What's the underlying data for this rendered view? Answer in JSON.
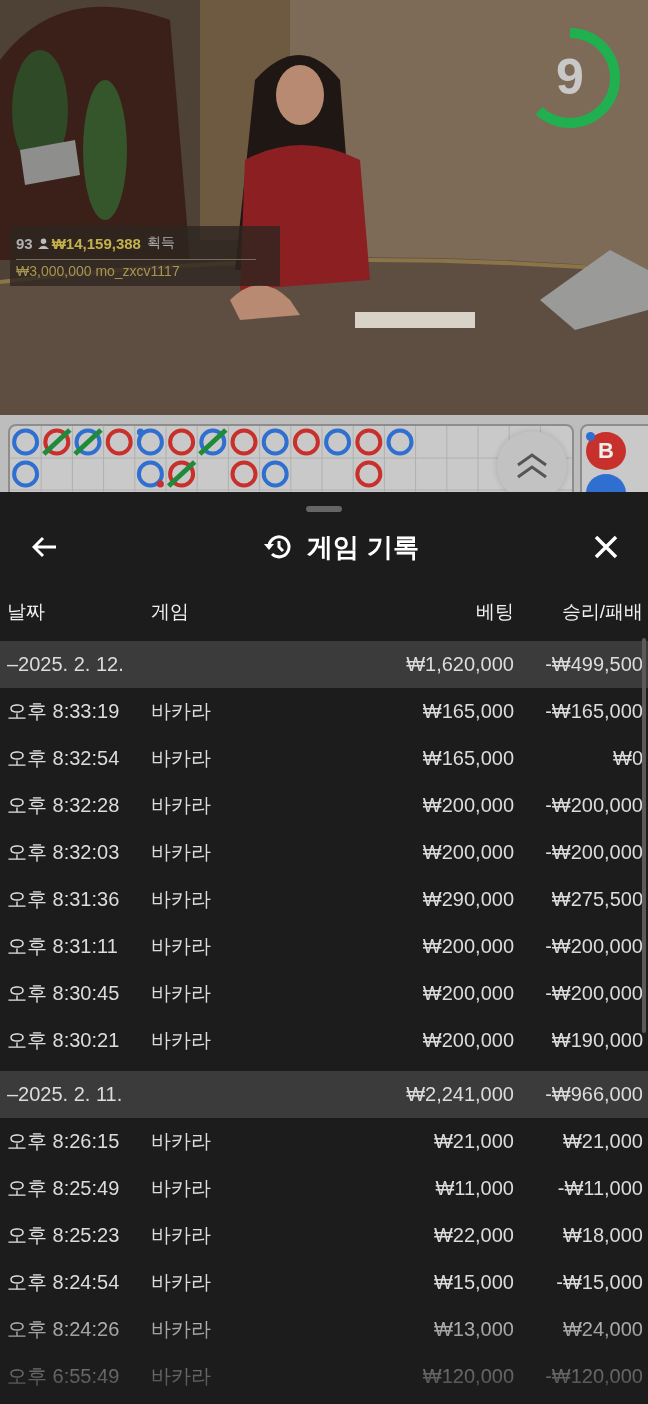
{
  "video": {
    "kind": "picture",
    "timer": {
      "value": "9",
      "level": 0.62
    },
    "winner": {
      "count": "93",
      "amount": "₩14,159,388",
      "label": "획득"
    },
    "bet_feed": "₩3,000,000 mo_zxcv1117"
  },
  "bead_road": {
    "columns": [
      [
        {
          "color": "#2f6fd0",
          "tie": false,
          "player_pair": false,
          "banker_pair": false
        },
        {
          "color": "#2f6fd0",
          "tie": false,
          "player_pair": false,
          "banker_pair": false
        }
      ],
      [
        {
          "color": "#c8302c",
          "tie": true,
          "player_pair": false,
          "banker_pair": false
        }
      ],
      [
        {
          "color": "#2f6fd0",
          "tie": true,
          "player_pair": false,
          "banker_pair": false
        }
      ],
      [
        {
          "color": "#c8302c",
          "tie": false,
          "player_pair": false,
          "banker_pair": false
        }
      ],
      [
        {
          "color": "#2f6fd0",
          "tie": false,
          "player_pair": true,
          "banker_pair": false
        },
        {
          "color": "#2f6fd0",
          "tie": false,
          "player_pair": false,
          "banker_pair": true
        }
      ],
      [
        {
          "color": "#c8302c",
          "tie": false,
          "player_pair": false,
          "banker_pair": false
        },
        {
          "color": "#c8302c",
          "tie": true,
          "player_pair": false,
          "banker_pair": false
        }
      ],
      [
        {
          "color": "#2f6fd0",
          "tie": true,
          "player_pair": false,
          "banker_pair": false
        }
      ],
      [
        {
          "color": "#c8302c",
          "tie": false,
          "player_pair": false,
          "banker_pair": false
        },
        {
          "color": "#c8302c",
          "tie": false,
          "player_pair": false,
          "banker_pair": false
        }
      ],
      [
        {
          "color": "#2f6fd0",
          "tie": false,
          "player_pair": false,
          "banker_pair": false
        },
        {
          "color": "#2f6fd0",
          "tie": false,
          "player_pair": false,
          "banker_pair": false
        }
      ],
      [
        {
          "color": "#c8302c",
          "tie": false,
          "player_pair": false,
          "banker_pair": false
        }
      ],
      [
        {
          "color": "#2f6fd0",
          "tie": false,
          "player_pair": false,
          "banker_pair": false
        }
      ],
      [
        {
          "color": "#c8302c",
          "tie": false,
          "player_pair": false,
          "banker_pair": false
        },
        {
          "color": "#c8302c",
          "tie": false,
          "player_pair": false,
          "banker_pair": false
        }
      ],
      [
        {
          "color": "#2f6fd0",
          "tie": false,
          "player_pair": false,
          "banker_pair": false
        }
      ]
    ]
  },
  "side_road": [
    {
      "label": "B",
      "color": "#c8302c",
      "player_pair": true
    },
    {
      "color": "#2f6fd0",
      "player_pair": false
    }
  ],
  "sheet": {
    "title": "게임 기록",
    "columns": [
      "날짜",
      "게임",
      "베팅",
      "승리/패배"
    ],
    "groups": [
      {
        "date": "–2025. 2. 12.",
        "bet": "₩1,620,000",
        "result": "-₩499,500",
        "rows": [
          {
            "time": "오후 8:33:19",
            "game": "바카라",
            "bet": "₩165,000",
            "result": "-₩165,000"
          },
          {
            "time": "오후 8:32:54",
            "game": "바카라",
            "bet": "₩165,000",
            "result": "₩0"
          },
          {
            "time": "오후 8:32:28",
            "game": "바카라",
            "bet": "₩200,000",
            "result": "-₩200,000"
          },
          {
            "time": "오후 8:32:03",
            "game": "바카라",
            "bet": "₩200,000",
            "result": "-₩200,000"
          },
          {
            "time": "오후 8:31:36",
            "game": "바카라",
            "bet": "₩290,000",
            "result": "₩275,500"
          },
          {
            "time": "오후 8:31:11",
            "game": "바카라",
            "bet": "₩200,000",
            "result": "-₩200,000"
          },
          {
            "time": "오후 8:30:45",
            "game": "바카라",
            "bet": "₩200,000",
            "result": "-₩200,000"
          },
          {
            "time": "오후 8:30:21",
            "game": "바카라",
            "bet": "₩200,000",
            "result": "₩190,000"
          }
        ]
      },
      {
        "date": "–2025. 2. 11.",
        "bet": "₩2,241,000",
        "result": "-₩966,000",
        "rows": [
          {
            "time": "오후 8:26:15",
            "game": "바카라",
            "bet": "₩21,000",
            "result": "₩21,000"
          },
          {
            "time": "오후 8:25:49",
            "game": "바카라",
            "bet": "₩11,000",
            "result": "-₩11,000"
          },
          {
            "time": "오후 8:25:23",
            "game": "바카라",
            "bet": "₩22,000",
            "result": "₩18,000"
          },
          {
            "time": "오후 8:24:54",
            "game": "바카라",
            "bet": "₩15,000",
            "result": "-₩15,000"
          },
          {
            "time": "오후 8:24:26",
            "game": "바카라",
            "bet": "₩13,000",
            "result": "₩24,000"
          },
          {
            "time": "오후 6:55:49",
            "game": "바카라",
            "bet": "₩120,000",
            "result": "-₩120,000"
          }
        ]
      }
    ]
  }
}
